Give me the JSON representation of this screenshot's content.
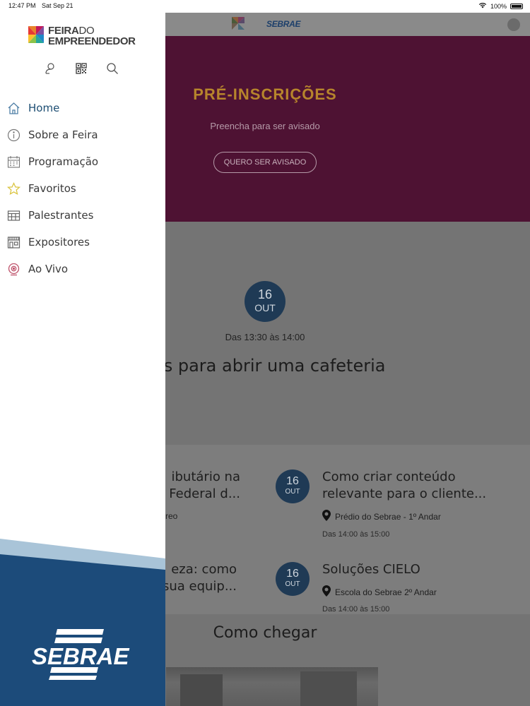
{
  "status_bar": {
    "time": "12:47 PM",
    "date": "Sat Sep 21",
    "battery": "100%"
  },
  "header": {
    "sebrae_logo": "SEBRAE"
  },
  "banner": {
    "title": "PRÉ-INSCRIÇÕES",
    "subtitle": "Preencha para ser avisado",
    "button": "QUERO SER AVISADO",
    "background": "#4e1233"
  },
  "featured": {
    "day": "16",
    "month": "OUT",
    "time": "Das 13:30 às 14:00",
    "title": "sos para abrir uma cafeteria"
  },
  "schedule": [
    {
      "title_line1": "ibutário na",
      "title_line2": "a Federal d...",
      "place": "reo"
    },
    {
      "day": "16",
      "month": "OUT",
      "title_line1": "Como criar conteúdo",
      "title_line2": "relevante para o cliente...",
      "place": "Prédio do Sebrae - 1º Andar",
      "time": "Das 14:00 às 15:00"
    },
    {
      "title_line1": "eza: como",
      "title_line2": "r sua equip..."
    },
    {
      "day": "16",
      "month": "OUT",
      "title_line1": "Soluções CIELO",
      "place": "Escola do Sebrae 2º Andar",
      "time": "Das 14:00 às 15:00"
    }
  ],
  "como_chegar": "Como chegar",
  "drawer": {
    "logo_line1": "FEIRA",
    "logo_line1_light": "DO",
    "logo_line2": "EMPREENDEDOR",
    "tools": [
      "profile-icon",
      "qrcode-icon",
      "search-icon"
    ],
    "menu": [
      {
        "label": "Home",
        "icon": "home-icon",
        "active": true
      },
      {
        "label": "Sobre a Feira",
        "icon": "info-icon"
      },
      {
        "label": "Programação",
        "icon": "calendar-icon"
      },
      {
        "label": "Favoritos",
        "icon": "star-icon"
      },
      {
        "label": "Palestrantes",
        "icon": "palestrantes-icon"
      },
      {
        "label": "Expositores",
        "icon": "store-icon"
      },
      {
        "label": "Ao Vivo",
        "icon": "live-icon"
      }
    ],
    "footer_logo": "SEBRAE",
    "footer_color": "#1c4b7a"
  }
}
